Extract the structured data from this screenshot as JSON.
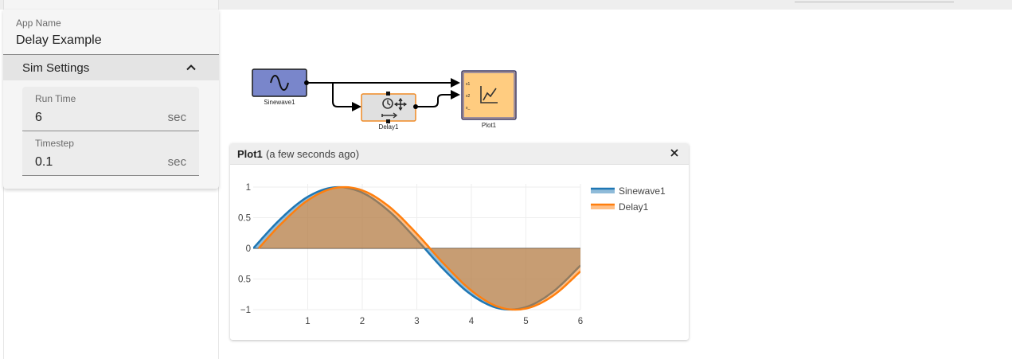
{
  "app": {
    "name_label": "App Name",
    "name_value": "Delay Example"
  },
  "sim_settings": {
    "title": "Sim Settings",
    "run_time": {
      "label": "Run Time",
      "value": "6",
      "unit": "sec"
    },
    "timestep": {
      "label": "Timestep",
      "value": "0.1",
      "unit": "sec"
    }
  },
  "diagram": {
    "blocks": [
      {
        "name": "Sinewave1",
        "icon": "sine-wave-icon",
        "color": "#7986cb"
      },
      {
        "name": "Delay1",
        "icon": "clock-delay-icon",
        "color": "#e0e0e0"
      },
      {
        "name": "Plot1",
        "icon": "line-chart-icon",
        "color": "#ffcc80"
      }
    ],
    "plot_ports": [
      "x1",
      "x2",
      "x_"
    ]
  },
  "plot_window": {
    "title": "Plot1",
    "subtitle": "(a few seconds ago)"
  },
  "chart_data": {
    "type": "area",
    "title": "",
    "xlabel": "",
    "ylabel": "",
    "xlim": [
      0,
      6
    ],
    "ylim": [
      -1,
      1
    ],
    "x_ticks": [
      "1",
      "2",
      "3",
      "4",
      "5",
      "6"
    ],
    "y_ticks": [
      "1",
      "0.5",
      "0",
      "0.5",
      "−1"
    ],
    "grid": true,
    "legend_position": "top-right",
    "series": [
      {
        "name": "Sinewave1",
        "color": "#1f77b4",
        "x": [
          0,
          0.5,
          1,
          1.5,
          2,
          2.5,
          3,
          3.5,
          4,
          4.5,
          5,
          5.5,
          6
        ],
        "y": [
          0,
          0.479,
          0.841,
          0.997,
          0.909,
          0.598,
          0.141,
          -0.351,
          -0.757,
          -0.978,
          -0.959,
          -0.706,
          -0.279
        ]
      },
      {
        "name": "Delay1",
        "color": "#ff7f0e",
        "x": [
          0.1,
          0.5,
          1,
          1.5,
          2,
          2.5,
          3,
          3.5,
          4,
          4.5,
          5,
          5.5,
          6
        ],
        "y": [
          0,
          0.389,
          0.783,
          0.986,
          0.946,
          0.675,
          0.239,
          -0.256,
          -0.688,
          -0.956,
          -0.982,
          -0.772,
          -0.375
        ]
      }
    ]
  }
}
